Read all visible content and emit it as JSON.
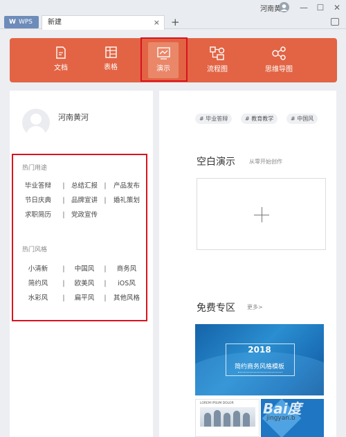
{
  "titlebar": {
    "username": "河南黄河",
    "minimize": "—",
    "maximize": "☐",
    "close": "✕"
  },
  "tabs": {
    "wps_label": "WPS",
    "new_tab_label": "新建",
    "close_glyph": "×",
    "add_glyph": "+"
  },
  "nav": {
    "items": [
      {
        "label": "文档",
        "icon": "document-icon"
      },
      {
        "label": "表格",
        "icon": "spreadsheet-icon"
      },
      {
        "label": "演示",
        "icon": "presentation-icon",
        "active": true
      },
      {
        "label": "流程图",
        "icon": "flowchart-icon"
      },
      {
        "label": "思维导图",
        "icon": "mindmap-icon"
      }
    ],
    "colors": {
      "background": "#e26444",
      "active": "#ea8769",
      "annotation": "#d9121f"
    }
  },
  "left": {
    "username": "河南黄河",
    "popular_uses": {
      "title": "热门用途",
      "rows": [
        [
          "毕业答辩",
          "总结汇报",
          "产品发布"
        ],
        [
          "节日庆典",
          "品牌宣讲",
          "婚礼策划"
        ],
        [
          "求职简历",
          "党政宣传"
        ]
      ]
    },
    "popular_styles": {
      "title": "热门风格",
      "rows": [
        [
          "小清新",
          "中国风",
          "商务风"
        ],
        [
          "简约风",
          "欧美风",
          "iOS风"
        ],
        [
          "水彩风",
          "扁平风",
          "其他风格"
        ]
      ]
    }
  },
  "right": {
    "tags": [
      "# 毕业答辩",
      "# 教育教学",
      "# 中国风"
    ],
    "blank": {
      "title": "空白演示",
      "subtitle": "从零开始创作",
      "plus": "+"
    },
    "free": {
      "title": "免费专区",
      "more": "更多>"
    },
    "banner": {
      "year": "2018",
      "title": "简约商务风格模板"
    },
    "thumb_label": "LOREM IPSUM DOLOR",
    "watermark": {
      "brand": "Bai度",
      "sub": "jingyan.b"
    }
  }
}
